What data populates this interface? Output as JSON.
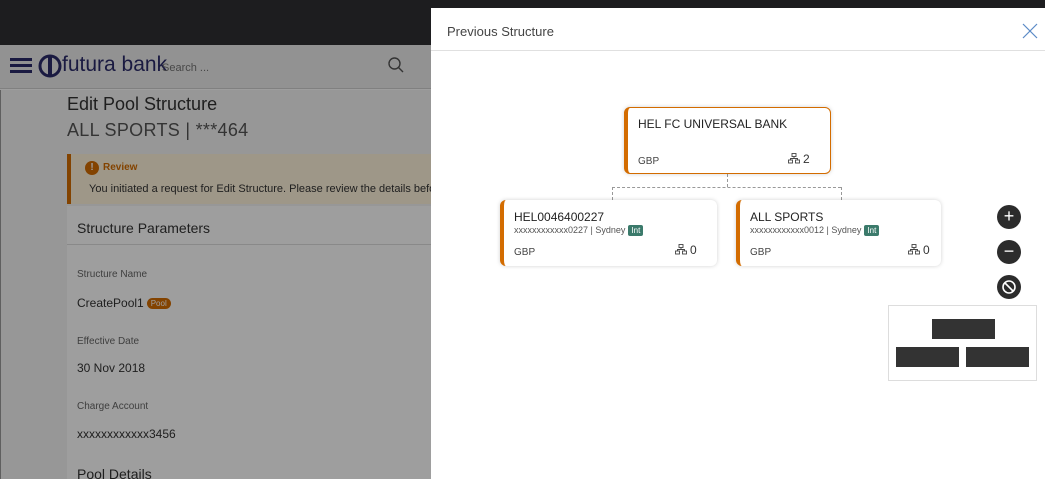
{
  "app": {
    "brand": "futura bank",
    "search_placeholder": "Search ..."
  },
  "page": {
    "title": "Edit Pool Structure",
    "subtitle": "ALL SPORTS | ***464",
    "review": {
      "title": "Review",
      "text": "You initiated a request for Edit Structure. Please review the details before you confirm!"
    },
    "section_title": "Structure Parameters",
    "fields": [
      {
        "label": "Structure Name",
        "value": "CreatePool1",
        "badge": "Pool"
      },
      {
        "label": "Effective Date",
        "value": "30 Nov 2018"
      },
      {
        "label": "Charge Account",
        "value": "xxxxxxxxxxxx3456"
      }
    ],
    "pool_details": "Pool Details"
  },
  "panel": {
    "title": "Previous Structure",
    "root": {
      "name": "HEL FC UNIVERSAL BANK",
      "currency": "GBP",
      "count": "2"
    },
    "children": [
      {
        "name": "HEL0046400227",
        "account": "xxxxxxxxxxxx0227 | Sydney",
        "badge": "Int",
        "currency": "GBP",
        "count": "0"
      },
      {
        "name": "ALL SPORTS",
        "account": "xxxxxxxxxxxx0012 | Sydney",
        "badge": "Int",
        "currency": "GBP",
        "count": "0"
      }
    ],
    "controls": {
      "zoom_in": "+",
      "zoom_out": "−"
    }
  },
  "colors": {
    "accent": "#d36c00",
    "brand": "#2b2b6a",
    "int_badge": "#3b7a6b"
  }
}
